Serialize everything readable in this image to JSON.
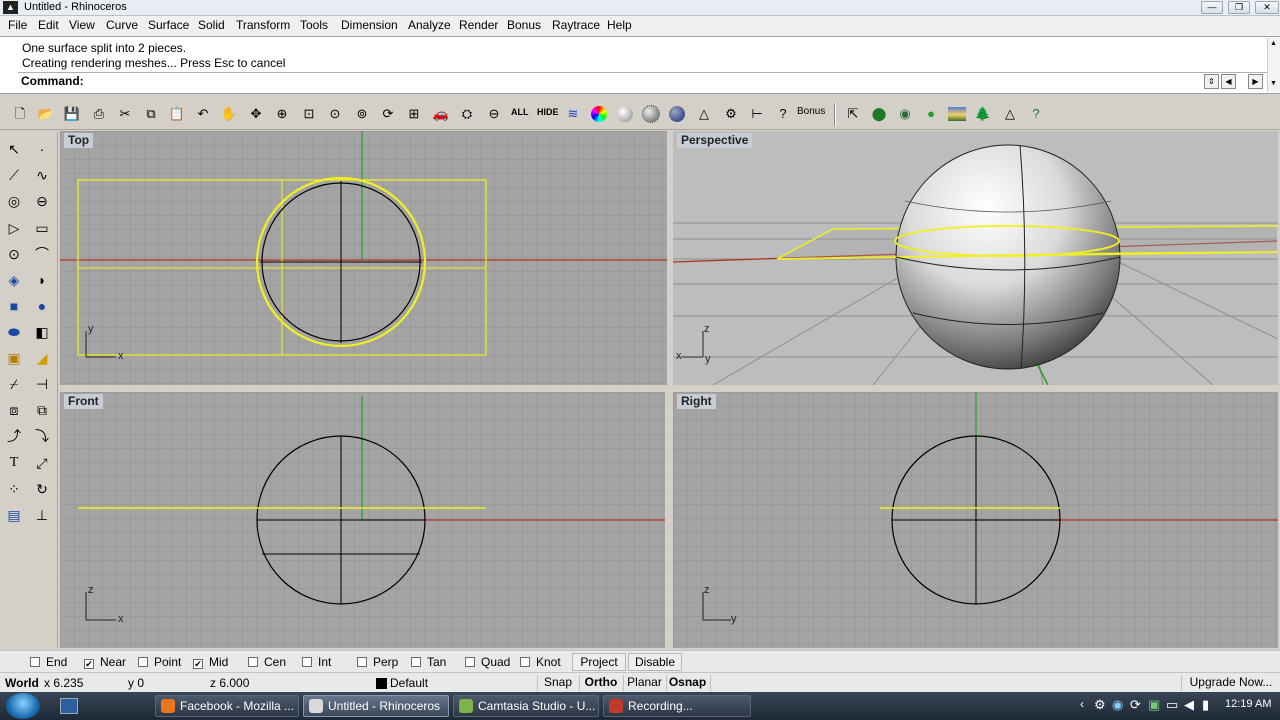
{
  "window": {
    "title": "Untitled - Rhinoceros"
  },
  "menu": [
    "File",
    "Edit",
    "View",
    "Curve",
    "Surface",
    "Solid",
    "Transform",
    "Tools",
    "Dimension",
    "Analyze",
    "Render",
    "Bonus",
    "Raytrace",
    "Help"
  ],
  "command": {
    "history": [
      "One surface split into 2 pieces.",
      "Creating rendering meshes... Press Esc to cancel"
    ],
    "prompt": "Command:",
    "value": ""
  },
  "toolbar": {
    "all_label": "ALL",
    "hide_label": "HIDE",
    "bonus_label": "Bonus"
  },
  "viewports": {
    "top": "Top",
    "perspective": "Perspective",
    "front": "Front",
    "right": "Right"
  },
  "axes": {
    "x": "x",
    "y": "y",
    "z": "z"
  },
  "osnaps": [
    {
      "label": "End",
      "checked": false
    },
    {
      "label": "Near",
      "checked": true
    },
    {
      "label": "Point",
      "checked": false
    },
    {
      "label": "Mid",
      "checked": true
    },
    {
      "label": "Cen",
      "checked": false
    },
    {
      "label": "Int",
      "checked": false
    },
    {
      "label": "Perp",
      "checked": false
    },
    {
      "label": "Tan",
      "checked": false
    },
    {
      "label": "Quad",
      "checked": false
    },
    {
      "label": "Knot",
      "checked": false
    }
  ],
  "osnap_buttons": {
    "project": "Project",
    "disable": "Disable"
  },
  "status": {
    "cplane": "World",
    "x": "x 6.235",
    "y": "y 0",
    "z": "z 6.000",
    "layer": "Default",
    "snap": "Snap",
    "ortho": "Ortho",
    "planar": "Planar",
    "osnap": "Osnap",
    "upgrade": "Upgrade Now..."
  },
  "taskbar": [
    {
      "label": "Facebook - Mozilla ...",
      "color": "#e8761c"
    },
    {
      "label": "Untitled - Rhinoceros",
      "color": "#d9d9d9"
    },
    {
      "label": "Camtasia Studio - U...",
      "color": "#7fb347"
    },
    {
      "label": "Recording...",
      "color": "#c0392b"
    }
  ],
  "clock": "12:19 AM",
  "colors": {
    "selection": "#f0f020",
    "x_axis": "#b03020",
    "y_axis": "#20a020",
    "curve": "#000000",
    "grid": "#a4a4a4"
  }
}
